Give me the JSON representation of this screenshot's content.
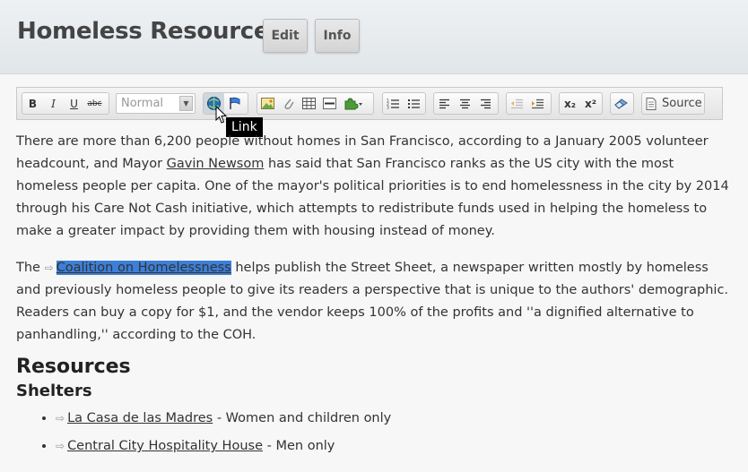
{
  "header": {
    "title": "Homeless Resources",
    "edit_label": "Edit",
    "info_label": "Info"
  },
  "toolbar": {
    "bold": "B",
    "italic": "I",
    "underline": "U",
    "strike": "abc",
    "format_value": "Normal",
    "subscript": "x₂",
    "superscript": "x²",
    "source_label": "Source",
    "tooltip": "Link"
  },
  "content": {
    "p1": {
      "a": "There are more than 6,200 people without homes in San Francisco, according to a January 2005 volunteer headcount, and Mayor ",
      "link": "Gavin Newsom",
      "b": " has said that San Francisco ranks as the US city with the most homeless people per capita. One of the mayor's political priorities is to end homelessness in the city by 2014 through his Care Not Cash initiative, which attempts to redistribute funds used in helping the homeless to make a greater impact by providing them with housing instead of money."
    },
    "p2": {
      "a": "The ",
      "link": "Coalition on Homelessness",
      "b": " helps publish the Street Sheet, a newspaper written mostly by homeless and previously homeless people to give its readers a perspective that is unique to the authors' demographic. Readers can buy a copy for $1, and the vendor keeps 100% of the profits and ''a dignified alternative to panhandling,'' according to the COH."
    },
    "h_resources": "Resources",
    "h_shelters": "Shelters",
    "shelters": [
      {
        "name": "La Casa de las Madres",
        "note": " - Women and children only"
      },
      {
        "name": "Central City Hospitality House",
        "note": " - Men only"
      }
    ]
  }
}
